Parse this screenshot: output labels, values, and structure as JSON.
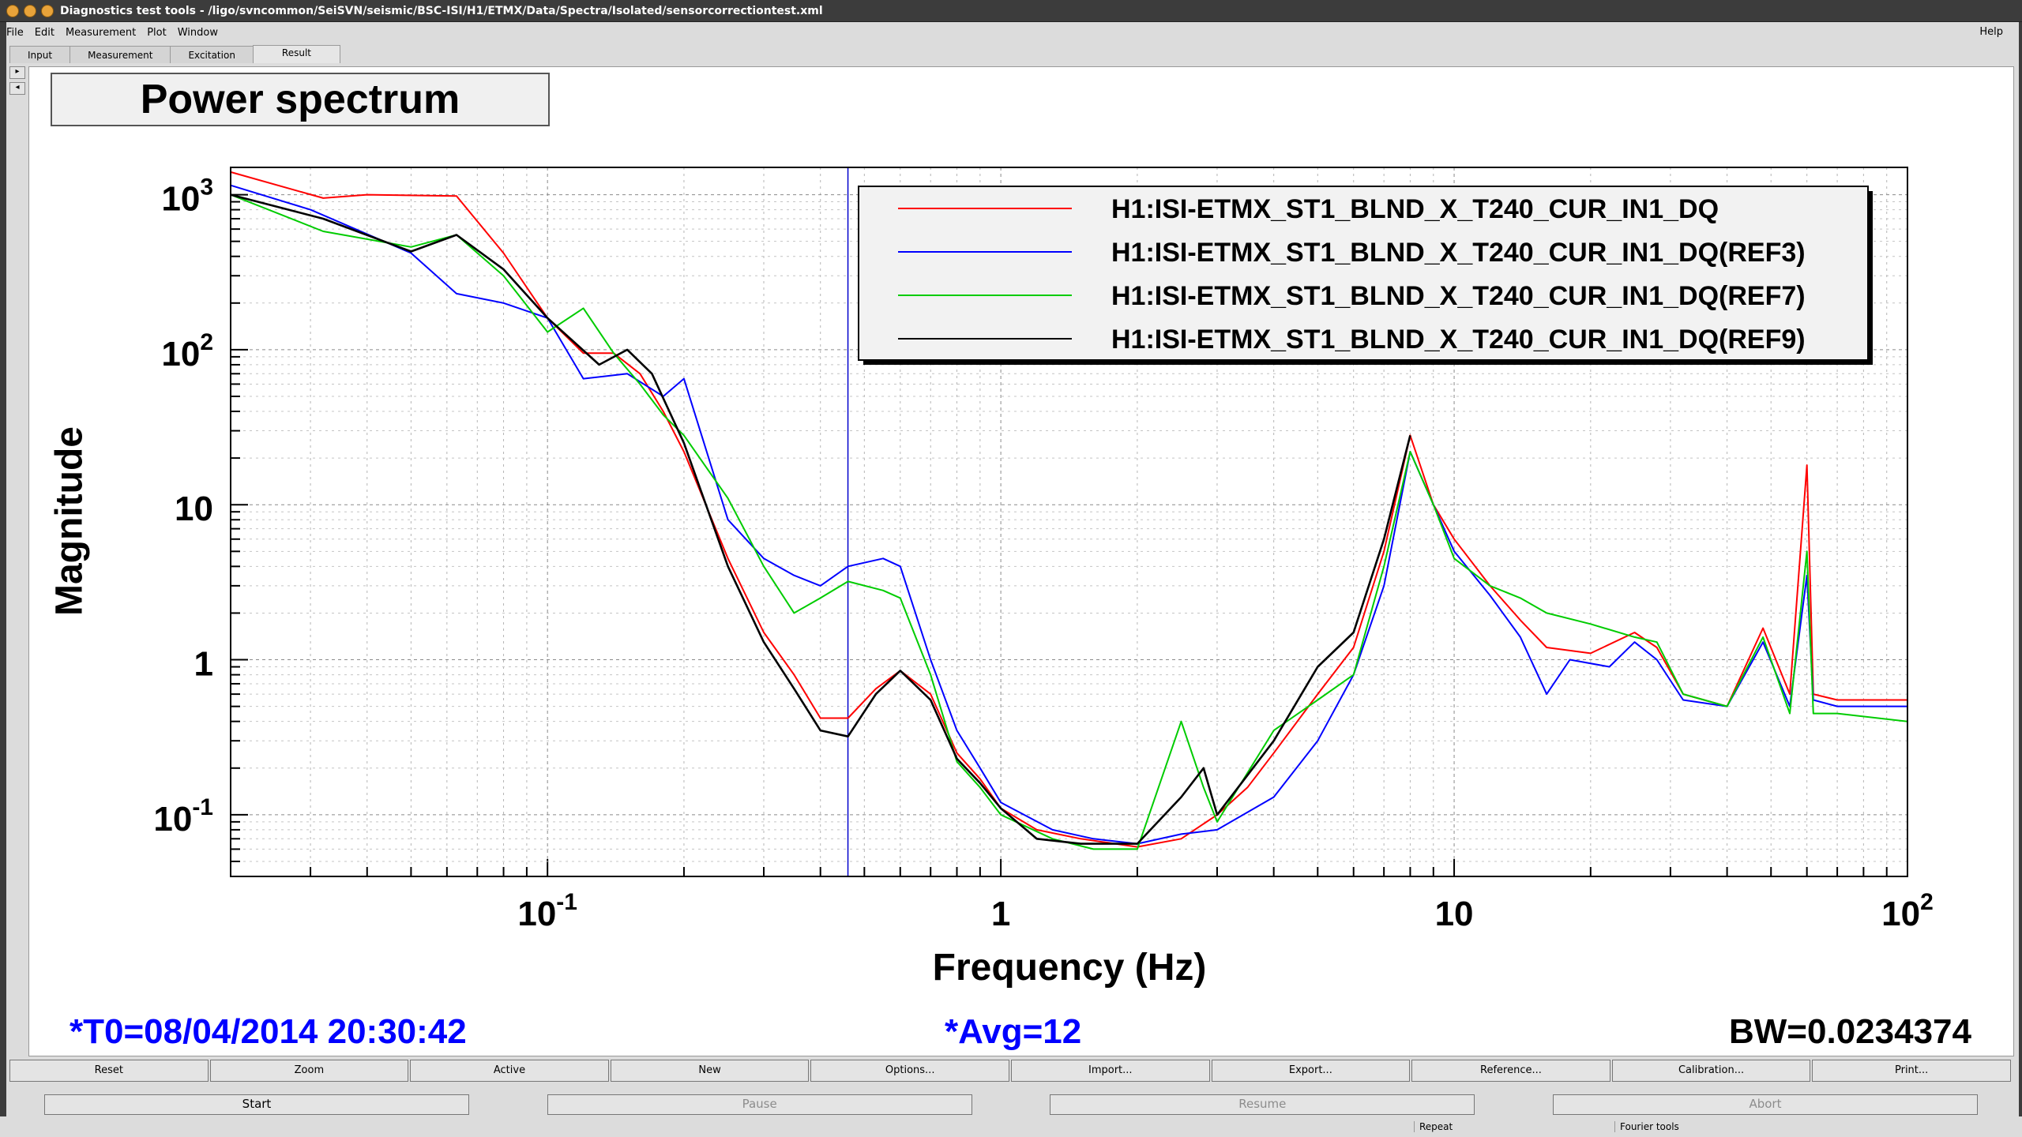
{
  "window": {
    "title": "Diagnostics test tools - /ligo/svncommon/SeiSVN/seismic/BSC-ISI/H1/ETMX/Data/Spectra/Isolated/sensorcorrectiontest.xml"
  },
  "menu": {
    "items": [
      "File",
      "Edit",
      "Measurement",
      "Plot",
      "Window"
    ],
    "help": "Help"
  },
  "tabs": [
    "Input",
    "Measurement",
    "Excitation",
    "Result"
  ],
  "active_tab": "Result",
  "plot": {
    "title": "Power spectrum",
    "footer_t0": "*T0=08/04/2014 20:30:42",
    "footer_avg": "*Avg=12",
    "footer_bw": "BW=0.0234374"
  },
  "colors": {
    "red": "#ff0000",
    "blue": "#0000ff",
    "green": "#00cc00",
    "black": "#000000",
    "footer_blue": "#0000ff",
    "cursor_line": "#0000cc"
  },
  "chart_data": {
    "type": "line",
    "title": "Power spectrum",
    "xlabel": "Frequency (Hz)",
    "ylabel": "Magnitude",
    "xscale": "log",
    "yscale": "log",
    "xlim": [
      0.02,
      100
    ],
    "ylim": [
      0.04,
      1500
    ],
    "grid": true,
    "legend_position": "top-right",
    "x_ticks": [
      {
        "v": 0.1,
        "base": "10",
        "exp": "-1"
      },
      {
        "v": 1,
        "base": "1",
        "exp": ""
      },
      {
        "v": 10,
        "base": "10",
        "exp": ""
      },
      {
        "v": 100,
        "base": "10",
        "exp": "2"
      }
    ],
    "y_ticks": [
      {
        "v": 1000,
        "base": "10",
        "exp": "3"
      },
      {
        "v": 100,
        "base": "10",
        "exp": "2"
      },
      {
        "v": 10,
        "base": "10",
        "exp": ""
      },
      {
        "v": 1,
        "base": "1",
        "exp": ""
      },
      {
        "v": 0.1,
        "base": "10",
        "exp": "-1"
      }
    ],
    "cursor_x": 0.46,
    "series": [
      {
        "name": "H1:ISI-ETMX_ST1_BLND_X_T240_CUR_IN1_DQ",
        "color": "#ff0000",
        "points": [
          [
            0.02,
            1400
          ],
          [
            0.032,
            950
          ],
          [
            0.04,
            1000
          ],
          [
            0.063,
            980
          ],
          [
            0.08,
            420
          ],
          [
            0.1,
            160
          ],
          [
            0.12,
            95
          ],
          [
            0.14,
            95
          ],
          [
            0.16,
            70
          ],
          [
            0.18,
            40
          ],
          [
            0.2,
            22
          ],
          [
            0.25,
            4.5
          ],
          [
            0.3,
            1.5
          ],
          [
            0.35,
            0.8
          ],
          [
            0.4,
            0.42
          ],
          [
            0.46,
            0.42
          ],
          [
            0.53,
            0.65
          ],
          [
            0.6,
            0.85
          ],
          [
            0.7,
            0.6
          ],
          [
            0.8,
            0.25
          ],
          [
            0.9,
            0.17
          ],
          [
            1.0,
            0.11
          ],
          [
            1.2,
            0.08
          ],
          [
            1.5,
            0.07
          ],
          [
            2.0,
            0.062
          ],
          [
            2.5,
            0.07
          ],
          [
            3.0,
            0.1
          ],
          [
            3.5,
            0.15
          ],
          [
            4.0,
            0.25
          ],
          [
            5.0,
            0.6
          ],
          [
            6.0,
            1.2
          ],
          [
            7.0,
            5.0
          ],
          [
            8.0,
            28
          ],
          [
            9.0,
            10
          ],
          [
            10,
            6
          ],
          [
            12,
            3
          ],
          [
            14,
            1.8
          ],
          [
            16,
            1.2
          ],
          [
            20,
            1.1
          ],
          [
            25,
            1.5
          ],
          [
            28,
            1.2
          ],
          [
            32,
            0.6
          ],
          [
            40,
            0.5
          ],
          [
            48,
            1.6
          ],
          [
            55,
            0.6
          ],
          [
            60,
            18
          ],
          [
            62,
            0.6
          ],
          [
            70,
            0.55
          ],
          [
            100,
            0.55
          ]
        ]
      },
      {
        "name": "H1:ISI-ETMX_ST1_BLND_X_T240_CUR_IN1_DQ(REF3)",
        "color": "#0000ff",
        "points": [
          [
            0.02,
            1150
          ],
          [
            0.03,
            800
          ],
          [
            0.05,
            420
          ],
          [
            0.063,
            230
          ],
          [
            0.08,
            200
          ],
          [
            0.1,
            160
          ],
          [
            0.12,
            65
          ],
          [
            0.15,
            70
          ],
          [
            0.18,
            50
          ],
          [
            0.2,
            65
          ],
          [
            0.25,
            8
          ],
          [
            0.3,
            4.5
          ],
          [
            0.35,
            3.5
          ],
          [
            0.4,
            3.0
          ],
          [
            0.46,
            4.0
          ],
          [
            0.55,
            4.5
          ],
          [
            0.6,
            4.0
          ],
          [
            0.7,
            1.0
          ],
          [
            0.8,
            0.35
          ],
          [
            0.9,
            0.2
          ],
          [
            1.0,
            0.12
          ],
          [
            1.3,
            0.08
          ],
          [
            1.6,
            0.07
          ],
          [
            2.0,
            0.065
          ],
          [
            2.5,
            0.075
          ],
          [
            3.0,
            0.08
          ],
          [
            4.0,
            0.13
          ],
          [
            5.0,
            0.3
          ],
          [
            6.0,
            0.8
          ],
          [
            7.0,
            3.0
          ],
          [
            8.0,
            22
          ],
          [
            9.0,
            10
          ],
          [
            10,
            5
          ],
          [
            12,
            2.6
          ],
          [
            14,
            1.4
          ],
          [
            16,
            0.6
          ],
          [
            18,
            1.0
          ],
          [
            22,
            0.9
          ],
          [
            25,
            1.3
          ],
          [
            28,
            1.0
          ],
          [
            32,
            0.55
          ],
          [
            40,
            0.5
          ],
          [
            48,
            1.3
          ],
          [
            55,
            0.5
          ],
          [
            60,
            3.5
          ],
          [
            62,
            0.55
          ],
          [
            70,
            0.5
          ],
          [
            100,
            0.5
          ]
        ]
      },
      {
        "name": "H1:ISI-ETMX_ST1_BLND_X_T240_CUR_IN1_DQ(REF7)",
        "color": "#00cc00",
        "points": [
          [
            0.02,
            1000
          ],
          [
            0.032,
            580
          ],
          [
            0.05,
            460
          ],
          [
            0.063,
            550
          ],
          [
            0.08,
            300
          ],
          [
            0.1,
            130
          ],
          [
            0.12,
            185
          ],
          [
            0.14,
            95
          ],
          [
            0.16,
            60
          ],
          [
            0.18,
            38
          ],
          [
            0.2,
            28
          ],
          [
            0.25,
            11
          ],
          [
            0.3,
            4.0
          ],
          [
            0.35,
            2.0
          ],
          [
            0.4,
            2.5
          ],
          [
            0.46,
            3.2
          ],
          [
            0.55,
            2.8
          ],
          [
            0.6,
            2.5
          ],
          [
            0.7,
            0.8
          ],
          [
            0.8,
            0.22
          ],
          [
            0.9,
            0.15
          ],
          [
            1.0,
            0.1
          ],
          [
            1.3,
            0.07
          ],
          [
            1.6,
            0.06
          ],
          [
            2.0,
            0.06
          ],
          [
            2.5,
            0.4
          ],
          [
            2.8,
            0.15
          ],
          [
            3.0,
            0.09
          ],
          [
            4.0,
            0.35
          ],
          [
            5.0,
            0.55
          ],
          [
            6.0,
            0.8
          ],
          [
            7.0,
            4.0
          ],
          [
            8.0,
            22
          ],
          [
            9.0,
            10
          ],
          [
            10,
            4.5
          ],
          [
            12,
            3.0
          ],
          [
            14,
            2.5
          ],
          [
            16,
            2.0
          ],
          [
            20,
            1.7
          ],
          [
            25,
            1.4
          ],
          [
            28,
            1.3
          ],
          [
            32,
            0.6
          ],
          [
            40,
            0.5
          ],
          [
            48,
            1.4
          ],
          [
            55,
            0.45
          ],
          [
            60,
            5.0
          ],
          [
            62,
            0.45
          ],
          [
            70,
            0.45
          ],
          [
            100,
            0.4
          ]
        ]
      },
      {
        "name": "H1:ISI-ETMX_ST1_BLND_X_T240_CUR_IN1_DQ(REF9)",
        "color": "#000000",
        "points": [
          [
            0.02,
            1000
          ],
          [
            0.032,
            700
          ],
          [
            0.05,
            430
          ],
          [
            0.063,
            550
          ],
          [
            0.08,
            330
          ],
          [
            0.1,
            160
          ],
          [
            0.13,
            80
          ],
          [
            0.15,
            100
          ],
          [
            0.17,
            70
          ],
          [
            0.2,
            25
          ],
          [
            0.25,
            4.0
          ],
          [
            0.3,
            1.3
          ],
          [
            0.35,
            0.65
          ],
          [
            0.4,
            0.35
          ],
          [
            0.46,
            0.32
          ],
          [
            0.53,
            0.6
          ],
          [
            0.6,
            0.85
          ],
          [
            0.7,
            0.55
          ],
          [
            0.8,
            0.23
          ],
          [
            0.9,
            0.16
          ],
          [
            1.0,
            0.11
          ],
          [
            1.2,
            0.07
          ],
          [
            1.5,
            0.065
          ],
          [
            2.0,
            0.065
          ],
          [
            2.5,
            0.13
          ],
          [
            2.8,
            0.2
          ],
          [
            3.0,
            0.1
          ],
          [
            3.5,
            0.18
          ],
          [
            4.0,
            0.3
          ],
          [
            5.0,
            0.9
          ],
          [
            6.0,
            1.5
          ],
          [
            7.0,
            6.0
          ],
          [
            8.0,
            28
          ]
        ]
      }
    ]
  },
  "buttons_row1": [
    "Reset",
    "Zoom",
    "Active",
    "New",
    "Options...",
    "Import...",
    "Export...",
    "Reference...",
    "Calibration...",
    "Print..."
  ],
  "buttons_row2": [
    {
      "label": "Start",
      "enabled": true
    },
    {
      "label": "Pause",
      "enabled": false
    },
    {
      "label": "Resume",
      "enabled": false
    },
    {
      "label": "Abort",
      "enabled": false
    }
  ],
  "status": {
    "repeat": "Repeat",
    "fourier": "Fourier tools"
  }
}
